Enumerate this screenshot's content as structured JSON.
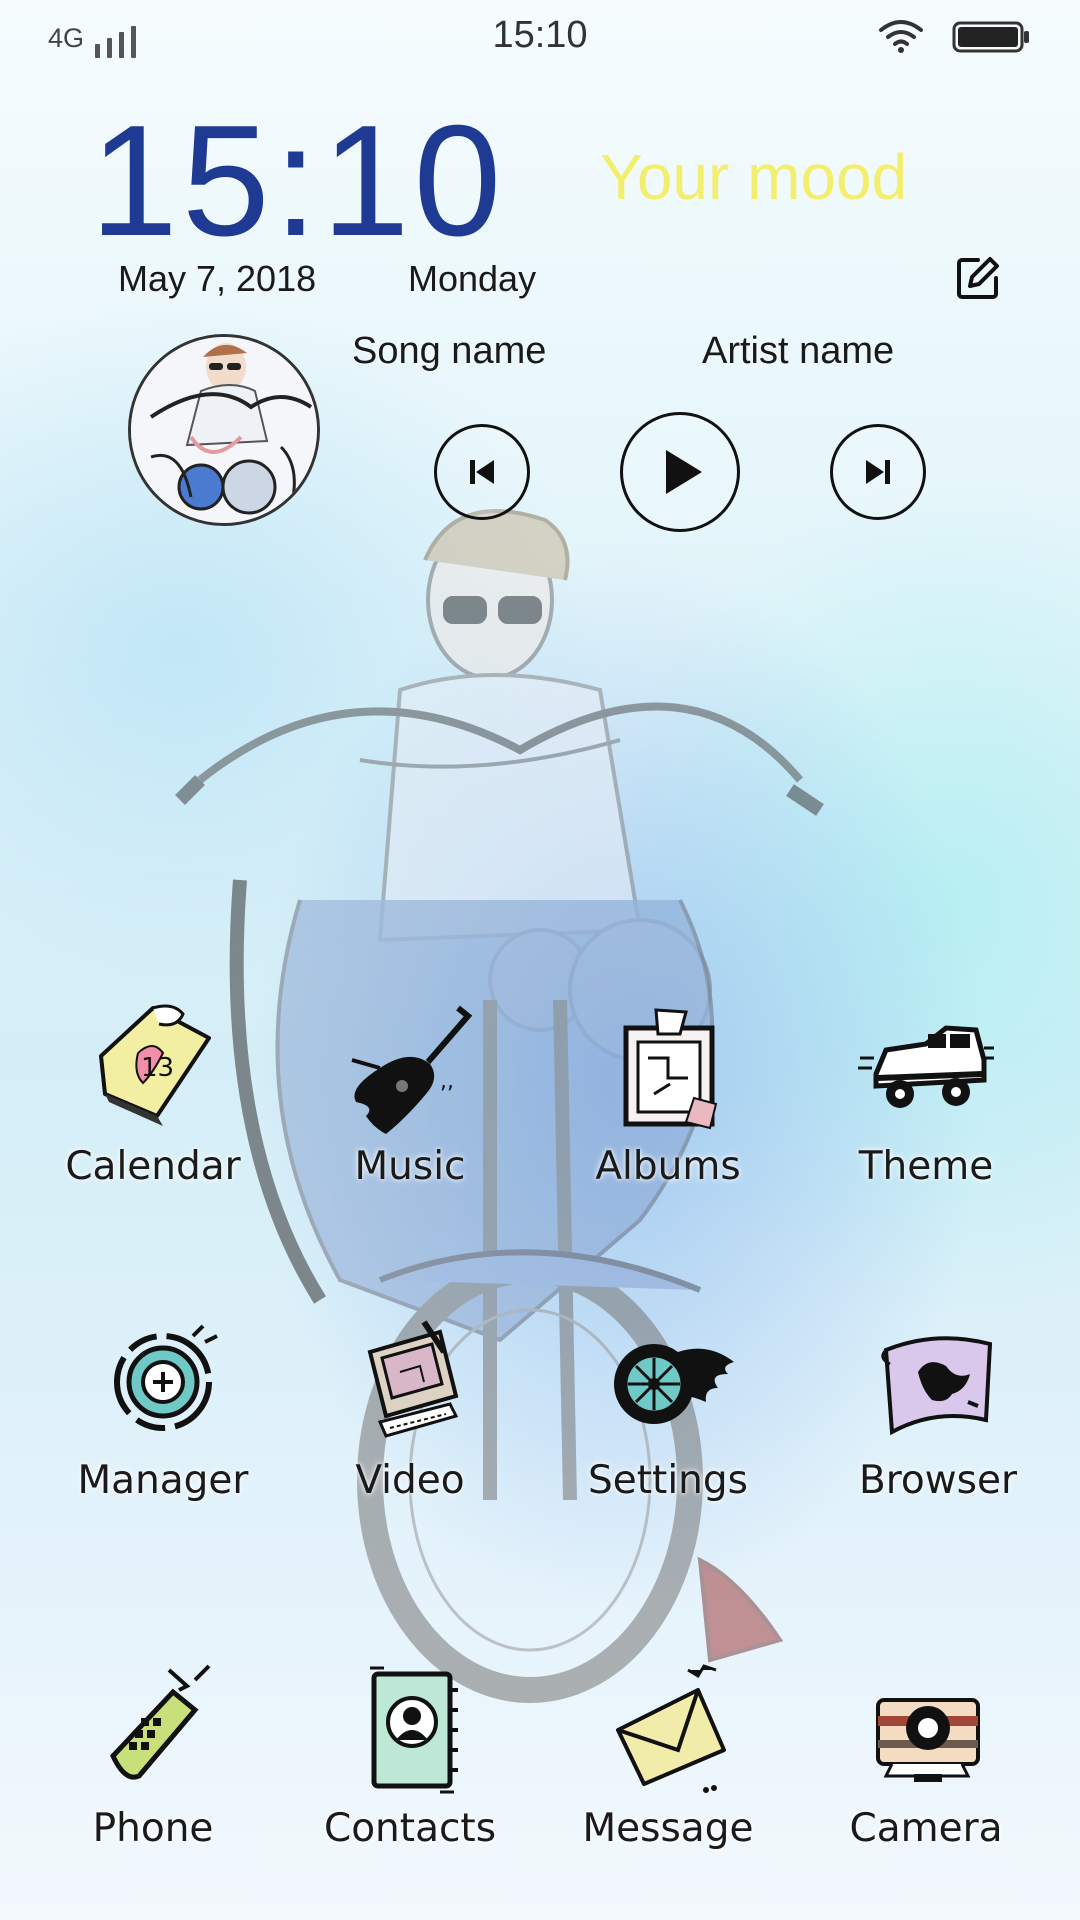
{
  "status_bar": {
    "network": "4G",
    "time": "15:10",
    "wifi_icon": "wifi-icon",
    "battery_icon": "battery-full-icon"
  },
  "clock_widget": {
    "time": "15:10",
    "mood": "Your mood",
    "date": "May 7, 2018",
    "weekday": "Monday",
    "edit_icon": "edit-icon",
    "mood_color": "#f3ef6d",
    "clock_color": "#1f3a93"
  },
  "music_widget": {
    "song": "Song name",
    "artist": "Artist name",
    "controls": [
      "previous-icon",
      "play-icon",
      "next-icon"
    ]
  },
  "apps": [
    {
      "label": "Calendar",
      "icon": "calendar-icon"
    },
    {
      "label": "Music",
      "icon": "guitar-icon"
    },
    {
      "label": "Albums",
      "icon": "album-icon"
    },
    {
      "label": "Theme",
      "icon": "jeep-icon"
    },
    {
      "label": "Manager",
      "icon": "manager-icon"
    },
    {
      "label": "Video",
      "icon": "video-icon"
    },
    {
      "label": "Settings",
      "icon": "wheel-icon"
    },
    {
      "label": "Browser",
      "icon": "map-icon"
    },
    {
      "label": "Phone",
      "icon": "phone-icon"
    },
    {
      "label": "Contacts",
      "icon": "contacts-icon"
    },
    {
      "label": "Message",
      "icon": "envelope-icon"
    },
    {
      "label": "Camera",
      "icon": "camera-icon"
    }
  ]
}
